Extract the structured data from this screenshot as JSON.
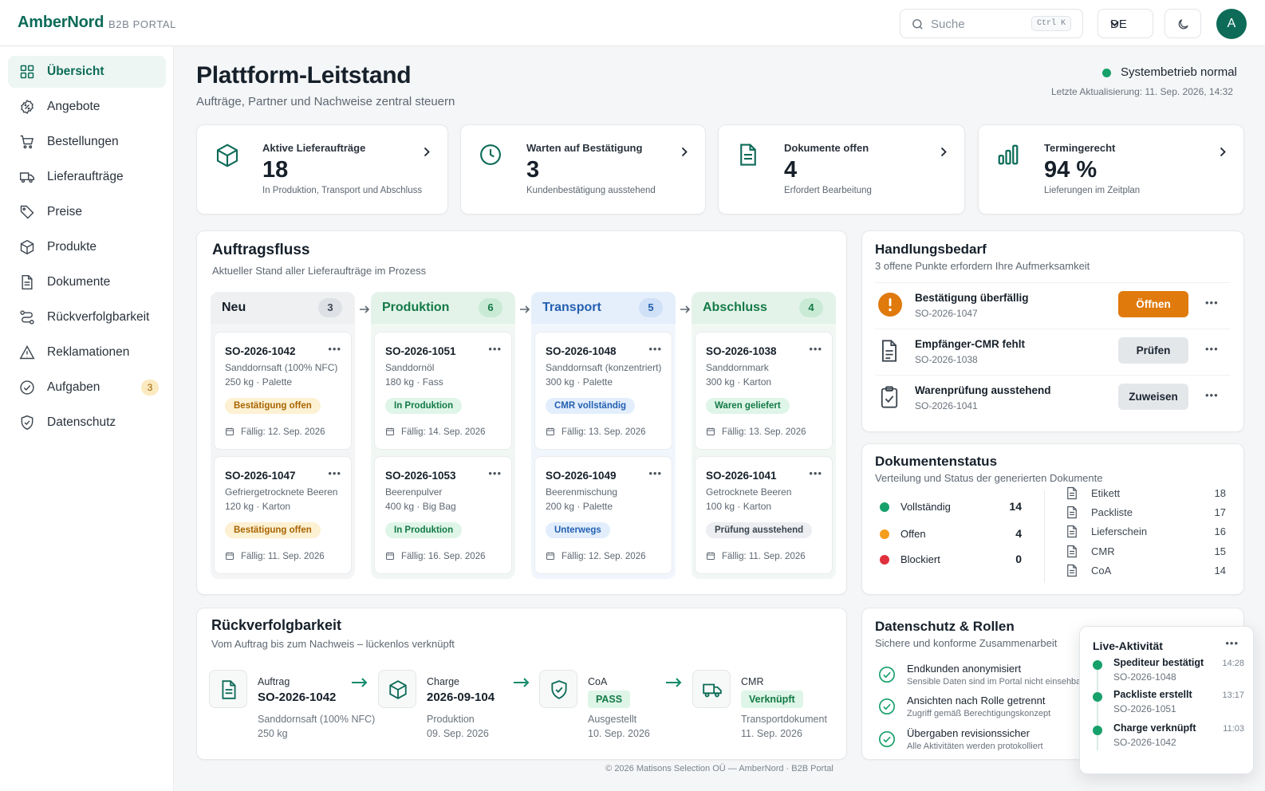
{
  "brand": {
    "name": "AmberNord",
    "sub": "B2B PORTAL"
  },
  "topbar": {
    "search_placeholder": "Suche",
    "shortcut": "Ctrl K",
    "language": "DE",
    "avatar_initial": "A"
  },
  "sidebar": {
    "items": [
      {
        "label": "Übersicht",
        "icon": "grid-icon",
        "active": true
      },
      {
        "label": "Angebote",
        "icon": "tag-percent-icon"
      },
      {
        "label": "Bestellungen",
        "icon": "cart-icon"
      },
      {
        "label": "Lieferaufträge",
        "icon": "truck-icon"
      },
      {
        "label": "Preise",
        "icon": "price-tag-icon"
      },
      {
        "label": "Produkte",
        "icon": "box-icon"
      },
      {
        "label": "Dokumente",
        "icon": "document-icon"
      },
      {
        "label": "Rückverfolgbarkeit",
        "icon": "route-icon"
      },
      {
        "label": "Reklamationen",
        "icon": "warning-icon"
      },
      {
        "label": "Aufgaben",
        "icon": "check-circle-icon",
        "badge": "3"
      },
      {
        "label": "Datenschutz",
        "icon": "shield-icon"
      }
    ]
  },
  "header": {
    "title": "Plattform-Leitstand",
    "subtitle": "Aufträge, Partner und Nachweise zentral steuern",
    "status": "Systembetrieb normal",
    "updated": "Letzte Aktualisierung: 11. Sep. 2026, 14:32"
  },
  "kpis": [
    {
      "title": "Aktive Lieferaufträge",
      "value": "18",
      "sub": "In Produktion, Transport und Abschluss",
      "icon": "box-icon"
    },
    {
      "title": "Warten auf Bestätigung",
      "value": "3",
      "sub": "Kundenbestätigung ausstehend",
      "icon": "clock-icon"
    },
    {
      "title": "Dokumente offen",
      "value": "4",
      "sub": "Erfordert Bearbeitung",
      "icon": "document-icon"
    },
    {
      "title": "Termingerecht",
      "value": "94 %",
      "sub": "Lieferungen im Zeitplan",
      "icon": "bar-chart-icon"
    }
  ],
  "flow": {
    "title": "Auftragsfluss",
    "subtitle": "Aktueller Stand aller Lieferaufträge im Prozess",
    "columns": [
      {
        "title": "Neu",
        "count": "3",
        "cards": [
          {
            "id": "SO-2026-1042",
            "product": "Sanddornsaft (100% NFC)",
            "qty": "250 kg · Palette",
            "tag": "Bestätigung offen",
            "tone": "amber",
            "due": "Fällig: 12. Sep. 2026"
          },
          {
            "id": "SO-2026-1047",
            "product": "Gefriergetrocknete Beeren",
            "qty": "120 kg · Karton",
            "tag": "Bestätigung offen",
            "tone": "amber",
            "due": "Fällig: 11. Sep. 2026"
          }
        ]
      },
      {
        "title": "Produktion",
        "count": "6",
        "cards": [
          {
            "id": "SO-2026-1051",
            "product": "Sanddornöl",
            "qty": "180 kg · Fass",
            "tag": "In Produktion",
            "tone": "green",
            "due": "Fällig: 14. Sep. 2026"
          },
          {
            "id": "SO-2026-1053",
            "product": "Beerenpulver",
            "qty": "400 kg · Big Bag",
            "tag": "In Produktion",
            "tone": "green",
            "due": "Fällig: 16. Sep. 2026"
          }
        ]
      },
      {
        "title": "Transport",
        "count": "5",
        "cards": [
          {
            "id": "SO-2026-1048",
            "product": "Sanddornsaft (konzentriert)",
            "qty": "300 kg · Palette",
            "tag": "CMR vollständig",
            "tone": "blue",
            "due": "Fällig: 13. Sep. 2026"
          },
          {
            "id": "SO-2026-1049",
            "product": "Beerenmischung",
            "qty": "200 kg · Palette",
            "tag": "Unterwegs",
            "tone": "blue",
            "due": "Fällig: 12. Sep. 2026"
          }
        ]
      },
      {
        "title": "Abschluss",
        "count": "4",
        "cards": [
          {
            "id": "SO-2026-1038",
            "product": "Sanddornmark",
            "qty": "300 kg · Karton",
            "tag": "Waren geliefert",
            "tone": "green",
            "due": "Fällig: 13. Sep. 2026"
          },
          {
            "id": "SO-2026-1041",
            "product": "Getrocknete Beeren",
            "qty": "100 kg · Karton",
            "tag": "Prüfung ausstehend",
            "tone": "gray",
            "due": "Fällig: 11. Sep. 2026"
          }
        ]
      }
    ]
  },
  "action": {
    "title": "Handlungsbedarf",
    "subtitle": "3 offene Punkte erfordern Ihre Aufmerksamkeit",
    "items": [
      {
        "title": "Bestätigung überfällig",
        "id": "SO-2026-1047",
        "button": "Öffnen",
        "icon": "alert-icon"
      },
      {
        "title": "Empfänger-CMR fehlt",
        "id": "SO-2026-1038",
        "button": "Prüfen",
        "icon": "document-icon"
      },
      {
        "title": "Warenprüfung ausstehend",
        "id": "SO-2026-1041",
        "button": "Zuweisen",
        "icon": "clipboard-check-icon"
      }
    ]
  },
  "docstatus": {
    "title": "Dokumentenstatus",
    "subtitle": "Verteilung und Status der generierten Dokumente",
    "status": [
      {
        "label": "Vollständig",
        "value": "14",
        "color": "#16a06a"
      },
      {
        "label": "Offen",
        "value": "4",
        "color": "#f59e1b"
      },
      {
        "label": "Blockiert",
        "value": "0",
        "color": "#e0303c"
      }
    ],
    "types": [
      {
        "label": "Etikett",
        "value": "18"
      },
      {
        "label": "Packliste",
        "value": "17"
      },
      {
        "label": "Lieferschein",
        "value": "16"
      },
      {
        "label": "CMR",
        "value": "15"
      },
      {
        "label": "CoA",
        "value": "14"
      }
    ]
  },
  "trace": {
    "title": "Rückverfolgbarkeit",
    "subtitle": "Vom Auftrag bis zum Nachweis – lückenlos verknüpft",
    "steps": [
      {
        "label": "Auftrag",
        "value": "SO-2026-1042",
        "s1": "Sanddornsaft (100% NFC)",
        "s2": "250 kg",
        "icon": "document-icon"
      },
      {
        "label": "Charge",
        "value": "2026-09-104",
        "s1": "Produktion",
        "s2": "09. Sep. 2026",
        "icon": "box-icon"
      },
      {
        "label": "CoA",
        "badge": "PASS",
        "s1": "Ausgestellt",
        "s2": "10. Sep. 2026",
        "icon": "shield-check-icon"
      },
      {
        "label": "CMR",
        "badge": "Verknüpft",
        "s1": "Transportdokument",
        "s2": "11. Sep. 2026",
        "icon": "truck-icon"
      }
    ]
  },
  "privacy": {
    "title": "Datenschutz & Rollen",
    "subtitle": "Sichere und konforme Zusammenarbeit",
    "items": [
      {
        "title": "Endkunden anonymisiert",
        "sub": "Sensible Daten sind im Portal nicht einsehbar"
      },
      {
        "title": "Ansichten nach Rolle getrennt",
        "sub": "Zugriff gemäß Berechtigungskonzept"
      },
      {
        "title": "Übergaben revisionssicher",
        "sub": "Alle Aktivitäten werden protokolliert"
      }
    ]
  },
  "live": {
    "title": "Live-Aktivität",
    "items": [
      {
        "title": "Spediteur bestätigt",
        "id": "SO-2026-1048",
        "time": "14:28"
      },
      {
        "title": "Packliste erstellt",
        "id": "SO-2026-1051",
        "time": "13:17"
      },
      {
        "title": "Charge verknüpft",
        "id": "SO-2026-1042",
        "time": "11:03"
      }
    ]
  },
  "footer": "© 2026 Matisons Selection OÜ — AmberNord · B2B Portal",
  "colors": {
    "brand": "#0d6b58",
    "accent": "#e07a0c",
    "success": "#16a06a",
    "info": "#245fb0"
  }
}
